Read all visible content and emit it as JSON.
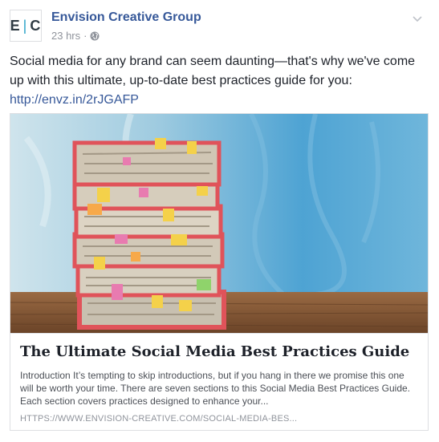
{
  "post": {
    "page_name": "Envision Creative Group",
    "avatar_text": "E|C",
    "avatar_left": "E",
    "avatar_right": "C",
    "timestamp": "23 hrs",
    "separator": "·",
    "audience_icon": "globe-icon",
    "menu_icon": "chevron-down-icon",
    "body_text": "Social media for any brand can seem daunting—that's why we've come up with this ultimate, up-to-date best practices guide for you:",
    "link_text": "http://envz.in/2rJGAFP"
  },
  "card": {
    "image_alt": "stack of binders with sticky notes",
    "title": "The Ultimate Social Media Best Practices Guide",
    "description": "Introduction It’s tempting to skip introductions, but if you hang in there we promise this one will be worth your time. There are seven sections to this Social Media Best Practices Guide. Each section covers practices designed to enhance your...",
    "domain": "HTTPS://WWW.ENVISION-CREATIVE.COM/SOCIAL-MEDIA-BES..."
  },
  "colors": {
    "link": "#365899",
    "meta": "#90949c",
    "accent_bar": "#2aa2c7",
    "binder_red": "#e0535a"
  }
}
